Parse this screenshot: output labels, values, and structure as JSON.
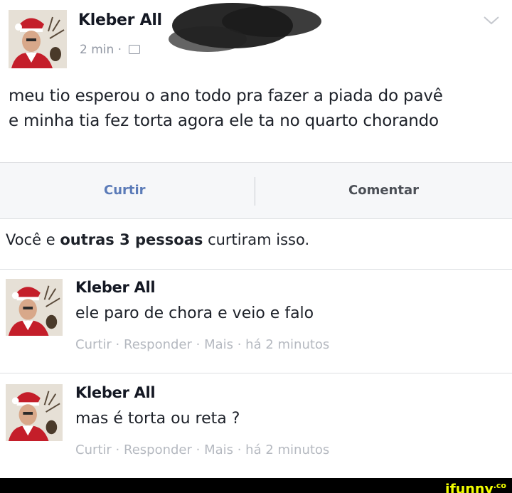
{
  "post": {
    "author": "Kleber All",
    "time": "2 min",
    "meta_sep": " · ",
    "text_line1": "meu tio esperou o ano todo pra fazer a piada do pavê",
    "text_line2": "e minha tia fez torta agora ele ta no quarto chorando"
  },
  "actions": {
    "like": "Curtir",
    "comment": "Comentar"
  },
  "likes": {
    "prefix": "Você e ",
    "bold": "outras 3 pessoas",
    "suffix": " curtiram isso."
  },
  "comments": [
    {
      "author": "Kleber All",
      "text": "ele paro de chora e veio e falo",
      "actions": "Curtir · Responder · Mais · há 2 minutos"
    },
    {
      "author": "Kleber All",
      "text": "mas é torta ou reta ?",
      "actions": "Curtir · Responder · Mais · há 2 minutos"
    }
  ],
  "watermark": {
    "text": "ifunny",
    "suffix": ".co"
  },
  "colors": {
    "like_blue": "#5b7bb8",
    "meta_gray": "#9197a3",
    "watermark_yellow": "#f2ff00"
  },
  "icons": [
    "avatar-photo",
    "globe-icon",
    "chevron-down-icon",
    "redaction-smudge"
  ]
}
